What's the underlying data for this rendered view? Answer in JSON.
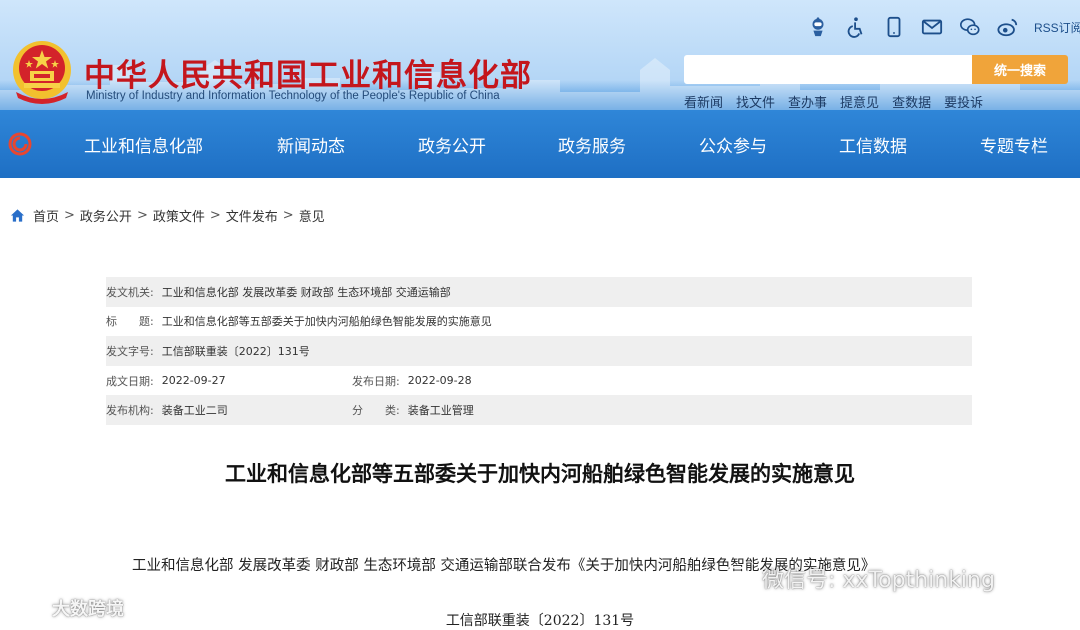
{
  "site": {
    "title_cn": "中华人民共和国工业和信息化部",
    "title_en": "Ministry of Industry and Information Technology of the People's Republic of China",
    "emblem": "national-emblem"
  },
  "tools": {
    "icons": [
      "robot-icon",
      "accessibility-icon",
      "mobile-icon",
      "mail-icon",
      "wechat-icon",
      "weibo-icon"
    ],
    "rss_label": "RSS订阅"
  },
  "search": {
    "value": "",
    "placeholder": "",
    "button_label": "统一搜索"
  },
  "quick_links": [
    "看新闻",
    "找文件",
    "查办事",
    "提意见",
    "查数据",
    "要投诉"
  ],
  "nav": {
    "items": [
      "工业和信息化部",
      "新闻动态",
      "政务公开",
      "政务服务",
      "公众参与",
      "工信数据",
      "专题专栏"
    ]
  },
  "breadcrumb": {
    "items": [
      "首页",
      "政务公开",
      "政策文件",
      "文件发布",
      "意见"
    ],
    "separator": ">"
  },
  "meta": {
    "issuer_label": "发文机关:",
    "issuer": "工业和信息化部 发展改革委 财政部 生态环境部 交通运输部",
    "title_label": "标　　题:",
    "title": "工业和信息化部等五部委关于加快内河船舶绿色智能发展的实施意见",
    "docno_label": "发文字号:",
    "docno": "工信部联重装〔2022〕131号",
    "created_label": "成文日期:",
    "created": "2022-09-27",
    "published_label": "发布日期:",
    "published": "2022-09-28",
    "org_label": "发布机构:",
    "org": "装备工业二司",
    "category_label": "分　　类:",
    "category": "装备工业管理"
  },
  "article": {
    "title": "工业和信息化部等五部委关于加快内河船舶绿色智能发展的实施意见",
    "lead": "工业和信息化部 发展改革委 财政部 生态环境部 交通运输部联合发布《关于加快内河船舶绿色智能发展的实施意见》",
    "doc_number": "工信部联重装〔2022〕131号"
  },
  "watermarks": {
    "right": "微信号: xxTopthinking",
    "left": "大数跨境"
  },
  "colors": {
    "title_red": "#c4161c",
    "nav_blue": "#1e6fc4",
    "search_orange": "#f0a43a",
    "meta_shade": "#efefef"
  }
}
